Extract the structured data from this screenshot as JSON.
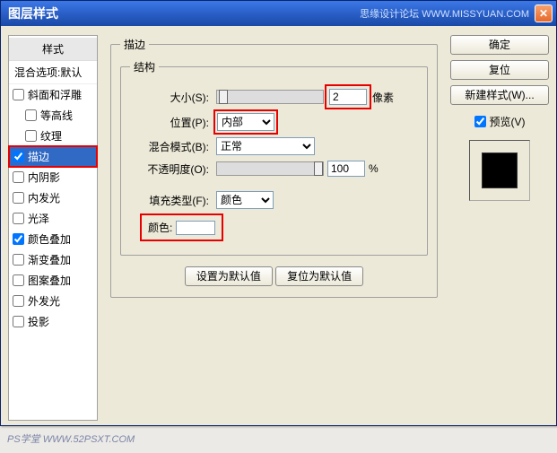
{
  "titlebar": {
    "title": "图层样式",
    "meta": "思缘设计论坛  WWW.MISSYUAN.COM"
  },
  "styles": {
    "header": "样式",
    "blend": "混合选项:默认",
    "items": [
      {
        "label": "斜面和浮雕",
        "checked": false,
        "nested": false
      },
      {
        "label": "等高线",
        "checked": false,
        "nested": true
      },
      {
        "label": "纹理",
        "checked": false,
        "nested": true
      },
      {
        "label": "描边",
        "checked": true,
        "nested": false,
        "selected": true,
        "highlight": true
      },
      {
        "label": "内阴影",
        "checked": false,
        "nested": false
      },
      {
        "label": "内发光",
        "checked": false,
        "nested": false
      },
      {
        "label": "光泽",
        "checked": false,
        "nested": false
      },
      {
        "label": "颜色叠加",
        "checked": true,
        "nested": false
      },
      {
        "label": "渐变叠加",
        "checked": false,
        "nested": false
      },
      {
        "label": "图案叠加",
        "checked": false,
        "nested": false
      },
      {
        "label": "外发光",
        "checked": false,
        "nested": false
      },
      {
        "label": "投影",
        "checked": false,
        "nested": false
      }
    ]
  },
  "stroke": {
    "legend_main": "描边",
    "legend_struct": "结构",
    "size_label": "大小(S):",
    "size_value": "2",
    "size_unit": "像素",
    "position_label": "位置(P):",
    "position_value": "内部",
    "blend_label": "混合模式(B):",
    "blend_value": "正常",
    "opacity_label": "不透明度(O):",
    "opacity_value": "100",
    "opacity_unit": "%",
    "filltype_label": "填充类型(F):",
    "filltype_value": "颜色",
    "color_label": "颜色:"
  },
  "buttons": {
    "default_set": "设置为默认值",
    "default_reset": "复位为默认值",
    "ok": "确定",
    "cancel": "复位",
    "newstyle": "新建样式(W)...",
    "preview": "预览(V)"
  },
  "watermark": "PS学堂  WWW.52PSXT.COM"
}
